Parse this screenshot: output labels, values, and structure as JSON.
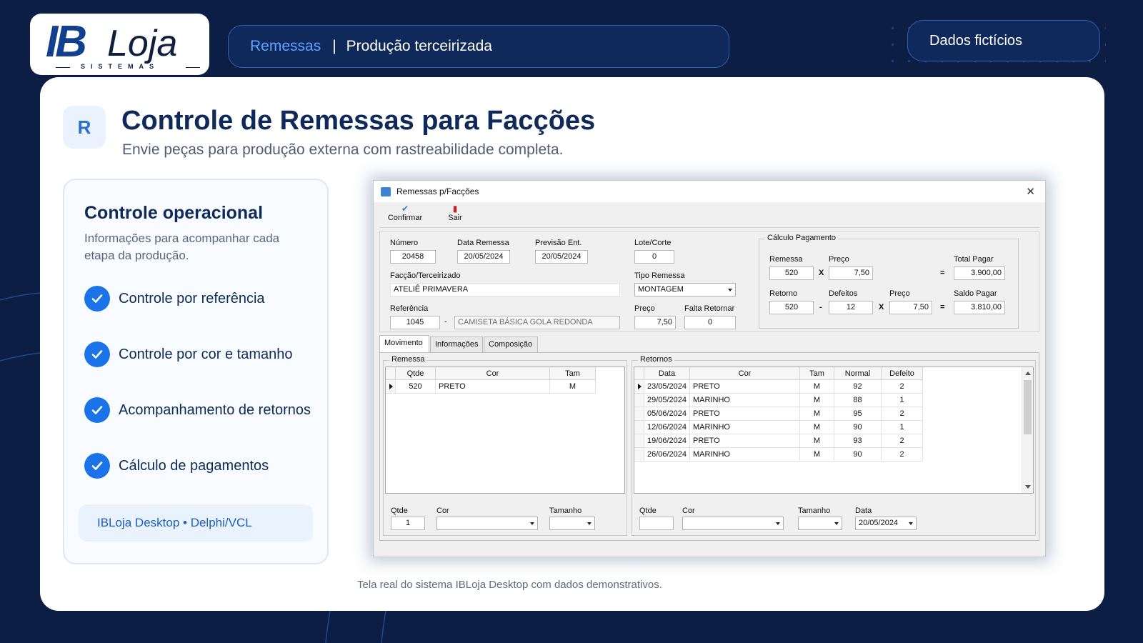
{
  "brand": {
    "logo_ib": "IB",
    "logo_loja": "Loja",
    "logo_sub": "SISTEMAS"
  },
  "header": {
    "breadcrumb_section": "Remessas",
    "breadcrumb_separator": "|",
    "breadcrumb_page": "Produção terceirizada",
    "badge": "Dados fictícios"
  },
  "page": {
    "icon_letter": "R",
    "title": "Controle de Remessas para Facções",
    "subtitle": "Envie peças para produção externa com rastreabilidade completa.",
    "caption": "Tela real do sistema IBLoja Desktop com dados demonstrativos."
  },
  "panel": {
    "title": "Controle operacional",
    "description": "Informações para acompanhar cada etapa da produção.",
    "features": [
      "Controle por referência",
      "Controle por cor e tamanho",
      "Acompanhamento de retornos",
      "Cálculo de pagamentos"
    ],
    "footer": "IBLoja Desktop • Delphi/VCL"
  },
  "colors": {
    "background": "#0c1e44",
    "accent": "#1a73e8",
    "check": "#1a73e8",
    "breadcrumb_active": "#5ea3ff"
  },
  "window": {
    "title": "Remessas p/Facções",
    "toolbar": {
      "confirm": "Confirmar",
      "exit": "Sair"
    },
    "labels": {
      "numero": "Número",
      "data_remessa": "Data Remessa",
      "previsao": "Previsão Ent.",
      "lote": "Lote/Corte",
      "faccao": "Facção/Terceirizado",
      "tipo_remessa": "Tipo Remessa",
      "referencia": "Referência",
      "ref_sep": "-",
      "preco": "Preço",
      "falta_retornar": "Falta Retornar"
    },
    "values": {
      "numero": "20458",
      "data_remessa": "20/05/2024",
      "previsao": "20/05/2024",
      "lote": "0",
      "faccao": "ATELIÊ PRIMAVERA",
      "tipo_remessa": "MONTAGEM",
      "referencia": "1045",
      "ref_descricao": "CAMISETA BÁSICA GOLA REDONDA",
      "preco": "7,50",
      "falta_retornar": "0"
    },
    "calculo": {
      "legend": "Cálculo Pagamento",
      "remessa_label": "Remessa",
      "preco_label": "Preço",
      "total_label": "Total Pagar",
      "retorno_label": "Retorno",
      "defeitos_label": "Defeitos",
      "preco2_label": "Preço",
      "saldo_label": "Saldo Pagar",
      "remessa": "520",
      "preco": "7,50",
      "total": "3.900,00",
      "retorno": "520",
      "defeitos": "12",
      "preco2": "7,50",
      "saldo": "3.810,00",
      "op_x": "X",
      "op_eq": "=",
      "op_minus": "-"
    },
    "tabs": [
      "Movimento",
      "Informações",
      "Composição"
    ],
    "remessa_grid": {
      "legend": "Remessa",
      "columns": [
        "Qtde",
        "Cor",
        "Tam"
      ],
      "rows": [
        [
          "520",
          "PRETO",
          "M"
        ]
      ]
    },
    "retornos_grid": {
      "legend": "Retornos",
      "columns": [
        "Data",
        "Cor",
        "Tam",
        "Normal",
        "Defeito"
      ],
      "rows": [
        [
          "23/05/2024",
          "PRETO",
          "M",
          "92",
          "2"
        ],
        [
          "29/05/2024",
          "MARINHO",
          "M",
          "88",
          "1"
        ],
        [
          "05/06/2024",
          "PRETO",
          "M",
          "95",
          "2"
        ],
        [
          "12/06/2024",
          "MARINHO",
          "M",
          "90",
          "1"
        ],
        [
          "19/06/2024",
          "PRETO",
          "M",
          "93",
          "2"
        ],
        [
          "26/06/2024",
          "MARINHO",
          "M",
          "90",
          "2"
        ]
      ]
    },
    "remessa_inputs": {
      "qtde_label": "Qtde",
      "cor_label": "Cor",
      "tamanho_label": "Tamanho",
      "qtde": "1",
      "cor": "",
      "tamanho": ""
    },
    "retorno_inputs": {
      "qtde_label": "Qtde",
      "cor_label": "Cor",
      "tamanho_label": "Tamanho",
      "data_label": "Data",
      "qtde": "",
      "cor": "",
      "tamanho": "",
      "data": "20/05/2024"
    }
  }
}
